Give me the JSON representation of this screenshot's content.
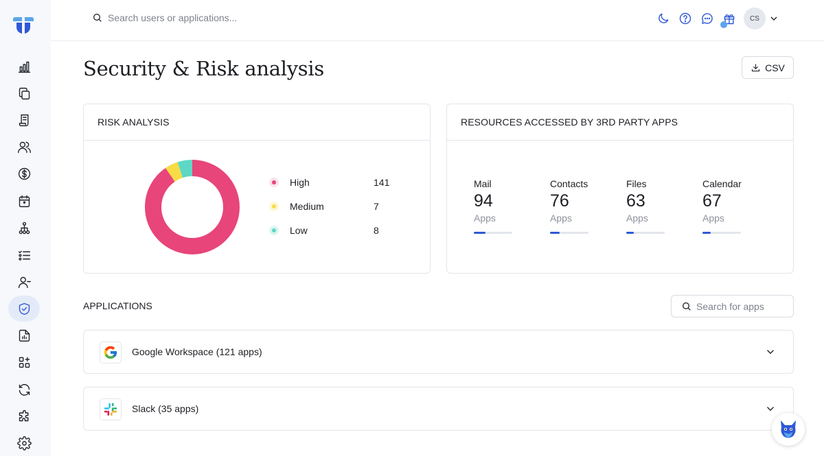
{
  "topbar": {
    "search_placeholder": "Search users or applications...",
    "avatar_initials": "CS",
    "icons": [
      "moon-icon",
      "help-icon",
      "chat-icon",
      "gift-icon"
    ]
  },
  "sidebar": {
    "items": [
      {
        "name": "dashboard",
        "icon": "bar-chart-icon",
        "active": false
      },
      {
        "name": "applications",
        "icon": "copy-icon",
        "active": false
      },
      {
        "name": "contracts",
        "icon": "document-icon",
        "active": false
      },
      {
        "name": "users",
        "icon": "users-icon",
        "active": false
      },
      {
        "name": "spend",
        "icon": "dollar-icon",
        "active": false
      },
      {
        "name": "renewals",
        "icon": "calendar-icon",
        "active": false
      },
      {
        "name": "workflows",
        "icon": "hierarchy-icon",
        "active": false
      },
      {
        "name": "tasks",
        "icon": "checklist-icon",
        "active": false
      },
      {
        "name": "offboarding",
        "icon": "user-minus-icon",
        "active": false
      },
      {
        "name": "security",
        "icon": "shield-icon",
        "active": true
      },
      {
        "name": "reports",
        "icon": "report-icon",
        "active": false
      },
      {
        "name": "integrations",
        "icon": "grid-plus-icon",
        "active": false
      },
      {
        "name": "sync",
        "icon": "sync-icon",
        "active": false
      },
      {
        "name": "plugins",
        "icon": "puzzle-icon",
        "active": false
      },
      {
        "name": "settings",
        "icon": "gear-icon",
        "active": false
      }
    ]
  },
  "page": {
    "title": "Security & Risk analysis",
    "csv_label": "CSV"
  },
  "risk": {
    "title": "RISK ANALYSIS",
    "items": [
      {
        "label": "High",
        "value": "141",
        "color": "#e8457a",
        "bg": "#fbe3ea"
      },
      {
        "label": "Medium",
        "value": "7",
        "color": "#f7dc45",
        "bg": "#fdf6d6"
      },
      {
        "label": "Low",
        "value": "8",
        "color": "#5ed8c4",
        "bg": "#dcf6f1"
      }
    ]
  },
  "chart_data": {
    "type": "pie",
    "categories": [
      "High",
      "Medium",
      "Low"
    ],
    "values": [
      141,
      7,
      8
    ],
    "colors": [
      "#e8457a",
      "#f7dc45",
      "#5ed8c4"
    ],
    "title": "RISK ANALYSIS"
  },
  "resources": {
    "title": "RESOURCES ACCESSED BY 3RD PARTY APPS",
    "items": [
      {
        "label": "Mail",
        "value": "94",
        "unit": "Apps",
        "fraction": 0.3
      },
      {
        "label": "Contacts",
        "value": "76",
        "unit": "Apps",
        "fraction": 0.25
      },
      {
        "label": "Files",
        "value": "63",
        "unit": "Apps",
        "fraction": 0.2
      },
      {
        "label": "Calendar",
        "value": "67",
        "unit": "Apps",
        "fraction": 0.21
      }
    ]
  },
  "applications": {
    "title": "APPLICATIONS",
    "search_placeholder": "Search for apps",
    "rows": [
      {
        "name": "Google Workspace (121 apps)",
        "icon": "google-icon"
      },
      {
        "name": "Slack (35 apps)",
        "icon": "slack-icon"
      }
    ]
  }
}
